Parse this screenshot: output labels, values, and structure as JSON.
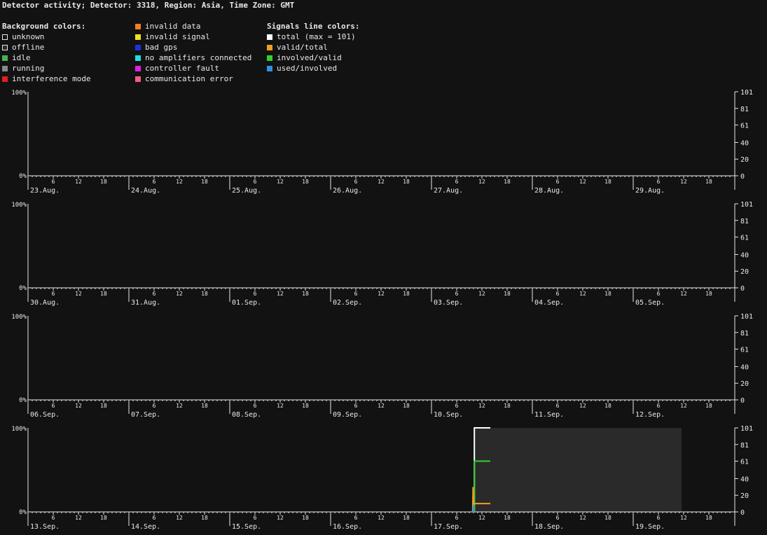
{
  "title": "Detector activity; Detector: 3318, Region: Asia, Time Zone: GMT",
  "legend": {
    "background": {
      "heading": "Background colors:",
      "items": [
        {
          "label": "unknown",
          "color": "#121212",
          "border": "#e8e8e8"
        },
        {
          "label": "offline",
          "color": "#2a2a2a",
          "border": "#e8e8e8"
        },
        {
          "label": "idle",
          "color": "#4caf50",
          "border": "#4caf50"
        },
        {
          "label": "running",
          "color": "#888888",
          "border": "#888888"
        },
        {
          "label": "interference mode",
          "color": "#e02020",
          "border": "#e02020"
        }
      ]
    },
    "status": {
      "items": [
        {
          "label": "invalid data",
          "color": "#f08020",
          "border": "#f08020"
        },
        {
          "label": "invalid signal",
          "color": "#f0e020",
          "border": "#f0e020"
        },
        {
          "label": "bad gps",
          "color": "#2030e0",
          "border": "#2030e0"
        },
        {
          "label": "no amplifiers connected",
          "color": "#20e0e0",
          "border": "#20e0e0"
        },
        {
          "label": "controller fault",
          "color": "#e020e0",
          "border": "#e020e0"
        },
        {
          "label": "communication error",
          "color": "#f06080",
          "border": "#f06080"
        }
      ]
    },
    "signals": {
      "heading": "Signals line colors:",
      "items": [
        {
          "label": "total (max = 101)",
          "color": "#ffffff",
          "border": "#ffffff"
        },
        {
          "label": "valid/total",
          "color": "#f0a020",
          "border": "#f0a020"
        },
        {
          "label": "involved/valid",
          "color": "#30d030",
          "border": "#30d030"
        },
        {
          "label": "used/involved",
          "color": "#3090e0",
          "border": "#3090e0"
        }
      ]
    }
  },
  "chart_data": {
    "type": "line",
    "y_left_labels": [
      "100%",
      "0%"
    ],
    "y_right_ticks": [
      101,
      81,
      61,
      40,
      20,
      0
    ],
    "hour_ticks": [
      6,
      12,
      18
    ],
    "rows": [
      {
        "days": [
          "23.Aug.",
          "24.Aug.",
          "25.Aug.",
          "26.Aug.",
          "27.Aug.",
          "28.Aug.",
          "29.Aug."
        ]
      },
      {
        "days": [
          "30.Aug.",
          "31.Aug.",
          "01.Sep.",
          "02.Sep.",
          "03.Sep.",
          "04.Sep.",
          "05.Sep."
        ]
      },
      {
        "days": [
          "06.Sep.",
          "07.Sep.",
          "08.Sep.",
          "09.Sep.",
          "10.Sep.",
          "11.Sep.",
          "12.Sep."
        ]
      },
      {
        "days": [
          "13.Sep.",
          "14.Sep.",
          "15.Sep.",
          "16.Sep.",
          "17.Sep.",
          "18.Sep.",
          "19.Sep."
        ],
        "offline_period": {
          "start_day": 4,
          "start_hour": 10.3,
          "end_day": 6,
          "end_hour": 11.5
        },
        "running_stripe": {
          "day": 4,
          "start_hour": 9.8,
          "end_hour": 10.3
        },
        "series": [
          {
            "name": "total (max = 101)",
            "color": "#ffffff",
            "points": [
              [
                4,
                9.8,
                0
              ],
              [
                4,
                10.2,
                0
              ],
              [
                4,
                10.2,
                101
              ],
              [
                4,
                14.0,
                101
              ]
            ]
          },
          {
            "name": "involved/valid",
            "color": "#30d030",
            "points": [
              [
                4,
                9.8,
                0
              ],
              [
                4,
                10.2,
                0
              ],
              [
                4,
                10.2,
                61
              ],
              [
                4,
                14.0,
                61
              ]
            ]
          },
          {
            "name": "valid/total",
            "color": "#f0a020",
            "points": [
              [
                4,
                9.8,
                0
              ],
              [
                4,
                9.9,
                30
              ],
              [
                4,
                10.0,
                10
              ],
              [
                4,
                10.2,
                10
              ],
              [
                4,
                14.0,
                10
              ]
            ]
          },
          {
            "name": "used/involved",
            "color": "#3090e0",
            "points": [
              [
                4,
                9.9,
                0
              ],
              [
                4,
                10.0,
                8
              ],
              [
                4,
                10.1,
                0
              ]
            ]
          }
        ]
      }
    ]
  }
}
